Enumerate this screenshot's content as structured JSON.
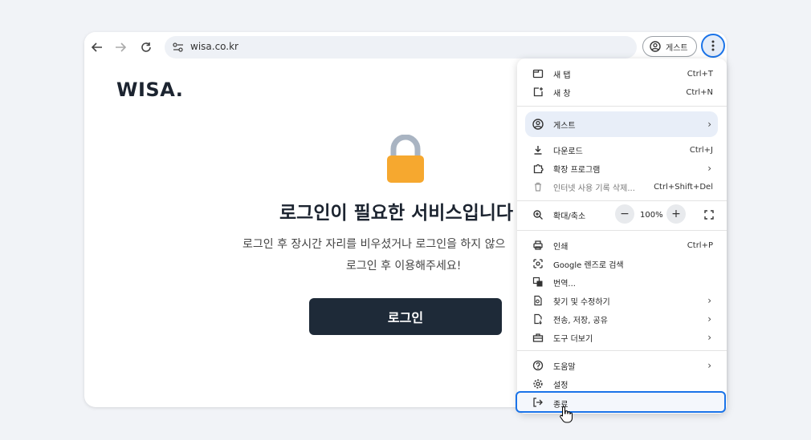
{
  "browser": {
    "url": "wisa.co.kr",
    "guest_label": "게스트"
  },
  "page": {
    "logo": "WISA.",
    "headline": "로그인이 필요한 서비스입니다",
    "desc_line1": "로그인 후 장시간 자리를 비우셨거나 로그인을 하지 않으",
    "desc_line2": "로그인 후 이용해주세요!",
    "login_button": "로그인"
  },
  "menu": {
    "new_tab": {
      "label": "새 탭",
      "shortcut": "Ctrl+T"
    },
    "new_window": {
      "label": "새 창",
      "shortcut": "Ctrl+N"
    },
    "guest": {
      "label": "게스트"
    },
    "downloads": {
      "label": "다운로드",
      "shortcut": "Ctrl+J"
    },
    "extensions": {
      "label": "확장 프로그램"
    },
    "clear_data": {
      "label": "인터넷 사용 기록 삭제...",
      "shortcut": "Ctrl+Shift+Del"
    },
    "zoom": {
      "label": "확대/축소",
      "minus": "−",
      "value": "100%",
      "plus": "+"
    },
    "print": {
      "label": "인쇄",
      "shortcut": "Ctrl+P"
    },
    "lens": {
      "label": "Google 렌즈로 검색"
    },
    "translate": {
      "label": "번역..."
    },
    "find_edit": {
      "label": "찾기 및 수정하기"
    },
    "cast_save_share": {
      "label": "전송, 저장, 공유"
    },
    "more_tools": {
      "label": "도구 더보기"
    },
    "help": {
      "label": "도움말"
    },
    "settings": {
      "label": "설정"
    },
    "exit": {
      "label": "종료"
    }
  },
  "colors": {
    "accent": "#1a73e8",
    "button_dark": "#1e2a38",
    "lock_body": "#f6a82f",
    "lock_shackle": "#a9b4c2"
  }
}
